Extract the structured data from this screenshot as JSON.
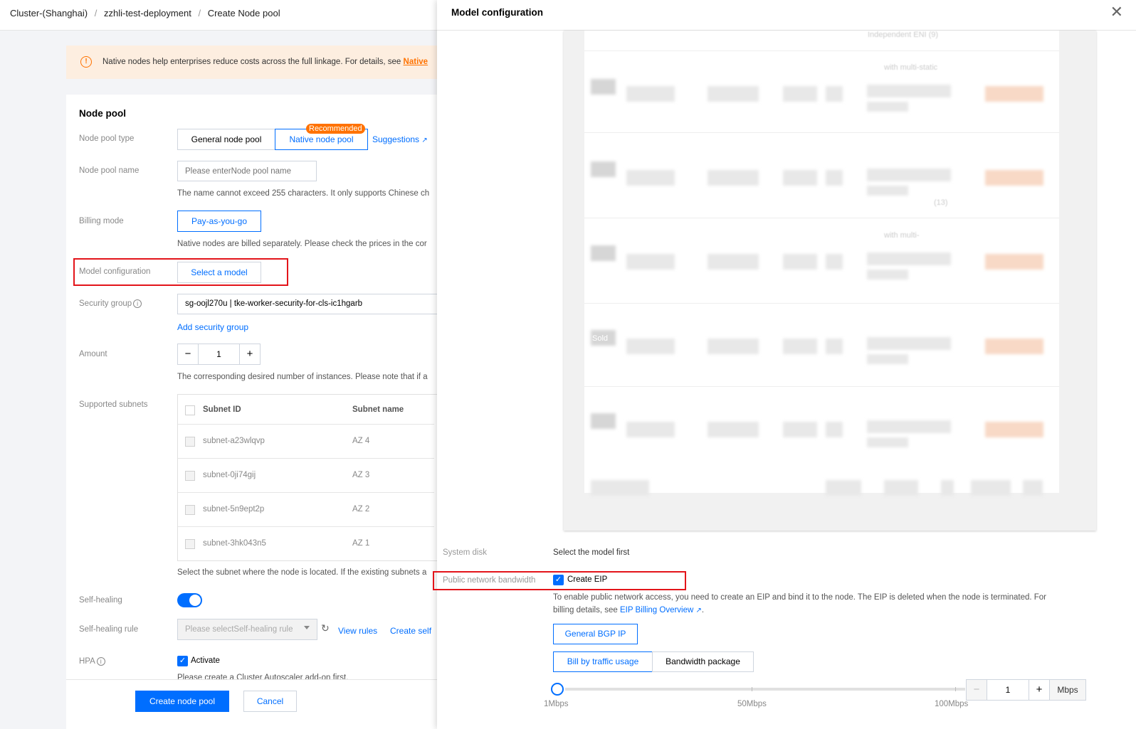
{
  "breadcrumb": {
    "cluster": "Cluster-(Shanghai)",
    "sep1": "/",
    "deployment": "zzhli-test-deployment",
    "sep2": "/",
    "current": "Create Node pool"
  },
  "notice": {
    "text": "Native nodes help enterprises reduce costs across the full linkage. For details, see",
    "link": "Native"
  },
  "form": {
    "section_title": "Node pool",
    "type_label": "Node pool type",
    "type_general": "General node pool",
    "type_native": "Native node pool",
    "recommended_badge": "Recommended",
    "suggestions_link": "Suggestions",
    "name_label": "Node pool name",
    "name_placeholder": "Please enterNode pool name",
    "name_hint": "The name cannot exceed 255 characters. It only supports Chinese ch",
    "billing_label": "Billing mode",
    "billing_value": "Pay-as-you-go",
    "billing_hint": "Native nodes are billed separately. Please check the prices in the cor",
    "model_label": "Model configuration",
    "model_button": "Select a model",
    "sg_label": "Security group",
    "sg_value": "sg-oojl270u | tke-worker-security-for-cls-ic1hgarb",
    "sg_add": "Add security group",
    "amount_label": "Amount",
    "amount_minus": "−",
    "amount_value": "1",
    "amount_plus": "+",
    "amount_hint": "The corresponding desired number of instances. Please note that if a",
    "subnets_label": "Supported subnets",
    "subnets_col_id": "Subnet ID",
    "subnets_col_name": "Subnet name",
    "subnets": [
      {
        "id": "subnet-a23wlqvp",
        "name": "AZ 4"
      },
      {
        "id": "subnet-0ji74gij",
        "name": "AZ 3"
      },
      {
        "id": "subnet-5n9ept2p",
        "name": "AZ 2"
      },
      {
        "id": "subnet-3hk043n5",
        "name": "AZ 1"
      }
    ],
    "subnets_hint": "Select the subnet where the node is located. If the existing subnets a",
    "selfheal_label": "Self-healing",
    "selfheal_rule_label": "Self-healing rule",
    "selfheal_rule_placeholder": "Please selectSelf-healing rule",
    "view_rules": "View rules",
    "create_self": "Create self",
    "hpa_label": "HPA",
    "hpa_activate": "Activate",
    "hpa_hint": "Please create a Cluster Autoscaler add-on first."
  },
  "footer": {
    "create": "Create node pool",
    "cancel": "Cancel"
  },
  "panel": {
    "title": "Model configuration",
    "blur_texts": {
      "eni": "Independent ENI (9)",
      "multi_static": "with multi-static",
      "paren13": "(13)",
      "multi": "with multi-",
      "sold": "Sold"
    },
    "system_disk_label": "System disk",
    "system_disk_value": "Select the model first",
    "bandwidth_label": "Public network bandwidth",
    "create_eip": "Create EIP",
    "eip_hint_line1": "To enable public network access, you need to create an EIP and bind it to the node. The EIP is deleted when the node is terminated. For",
    "eip_hint_line2": "billing details, see",
    "eip_link": "EIP Billing Overview",
    "eip_hint_end": ".",
    "bgp_button": "General BGP IP",
    "bill_traffic": "Bill by traffic usage",
    "bill_package": "Bandwidth package",
    "bandwidth_value": "1",
    "bandwidth_unit": "Mbps",
    "stepper_minus": "−",
    "stepper_plus": "+",
    "scale_min": "1Mbps",
    "scale_mid": "50Mbps",
    "scale_max": "100Mbps",
    "bandwidth_level": 1
  },
  "colors": {
    "accent": "#006eff",
    "warning": "#ff7200",
    "highlight": "#e3141a"
  }
}
